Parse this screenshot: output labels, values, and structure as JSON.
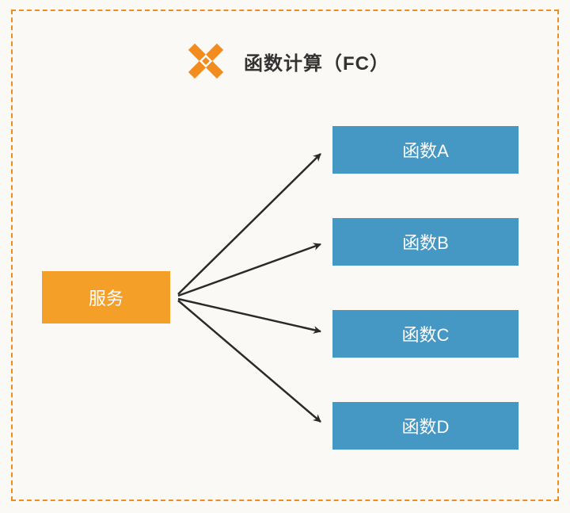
{
  "title": "函数计算（FC）",
  "source": {
    "label": "服务"
  },
  "functions": [
    {
      "label": "函数A"
    },
    {
      "label": "函数B"
    },
    {
      "label": "函数C"
    },
    {
      "label": "函数D"
    }
  ],
  "colors": {
    "frame": "#f28c1f",
    "source_bg": "#f4a028",
    "function_bg": "#4597c4",
    "text_light": "#ffffff",
    "title_text": "#333333"
  }
}
